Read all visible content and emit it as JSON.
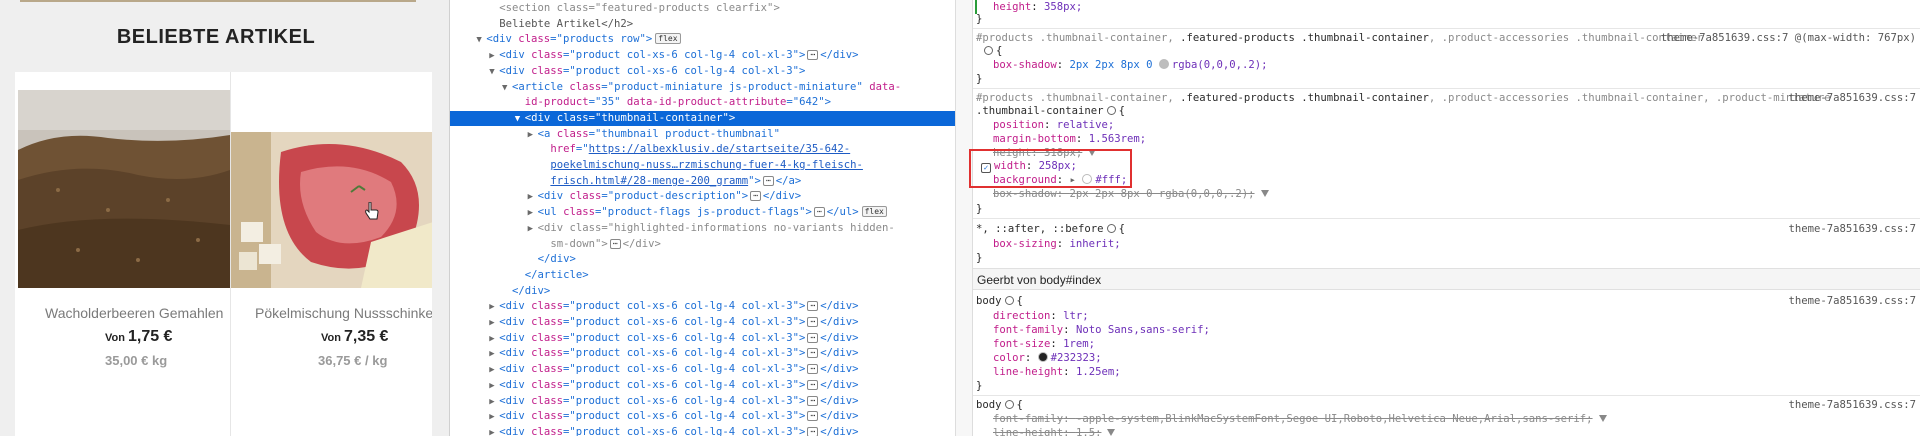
{
  "store": {
    "heading": "BELIEBTE ARTIKEL",
    "products": [
      {
        "name": "Wacholderbeeren Gemahlen",
        "von": "Von",
        "price": "1,75 €",
        "unit": "35,00 € kg"
      },
      {
        "name": "Pökelmischung Nussschinken",
        "von": "Von",
        "price": "7,35 €",
        "unit": "36,75 € / kg"
      }
    ]
  },
  "dom": {
    "lines": [
      {
        "indent": 8,
        "tw": "",
        "parts": [
          [
            "cm",
            "<section class=\"featured-products clearfix\">"
          ]
        ]
      },
      {
        "indent": 8,
        "tw": "",
        "parts": [
          [
            "tx",
            "Beliebte Artikel</h2>"
          ]
        ]
      },
      {
        "indent": 6,
        "tw": "▼",
        "parts": [
          [
            "tg",
            "<div "
          ],
          [
            "at",
            "class"
          ],
          [
            "tg",
            "=\""
          ],
          [
            "av",
            "products row"
          ],
          [
            "tg",
            "\">"
          ],
          [
            "badge",
            "flex"
          ]
        ]
      },
      {
        "indent": 8,
        "tw": "▶",
        "parts": [
          [
            "tg",
            "<div "
          ],
          [
            "at",
            "class"
          ],
          [
            "tg",
            "=\""
          ],
          [
            "av",
            "product col-xs-6 col-lg-4 col-xl-3"
          ],
          [
            "tg",
            "\">"
          ],
          [
            "dots",
            "⋯"
          ],
          [
            "tg",
            "</div>"
          ]
        ]
      },
      {
        "indent": 8,
        "tw": "▼",
        "parts": [
          [
            "tg",
            "<div "
          ],
          [
            "at",
            "class"
          ],
          [
            "tg",
            "=\""
          ],
          [
            "av",
            "product col-xs-6 col-lg-4 col-xl-3"
          ],
          [
            "tg",
            "\">"
          ]
        ]
      },
      {
        "indent": 10,
        "tw": "▼",
        "parts": [
          [
            "tg",
            "<article "
          ],
          [
            "at",
            "class"
          ],
          [
            "tg",
            "=\""
          ],
          [
            "av",
            "product-miniature js-product-miniature"
          ],
          [
            "tg",
            "\" "
          ],
          [
            "at",
            "data-"
          ]
        ]
      },
      {
        "indent": 12,
        "tw": "",
        "parts": [
          [
            "at",
            "id-product"
          ],
          [
            "tg",
            "=\""
          ],
          [
            "av",
            "35"
          ],
          [
            "tg",
            "\" "
          ],
          [
            "at",
            "data-id-product-attribute"
          ],
          [
            "tg",
            "=\""
          ],
          [
            "av",
            "642"
          ],
          [
            "tg",
            "\">"
          ]
        ]
      },
      {
        "indent": 12,
        "tw": "▼",
        "sel": true,
        "parts": [
          [
            "tg",
            "<div "
          ],
          [
            "at",
            "class"
          ],
          [
            "tg",
            "=\""
          ],
          [
            "av",
            "thumbnail-container"
          ],
          [
            "tg",
            "\">"
          ]
        ]
      },
      {
        "indent": 14,
        "tw": "▶",
        "parts": [
          [
            "tg",
            "<a "
          ],
          [
            "at",
            "class"
          ],
          [
            "tg",
            "=\""
          ],
          [
            "av",
            "thumbnail product-thumbnail"
          ],
          [
            "tg",
            "\""
          ]
        ]
      },
      {
        "indent": 16,
        "tw": "",
        "parts": [
          [
            "at",
            "href"
          ],
          [
            "tg",
            "=\""
          ],
          [
            "lk",
            "https://albexklusiv.de/startseite/35-642-"
          ]
        ]
      },
      {
        "indent": 16,
        "tw": "",
        "parts": [
          [
            "lk",
            "poekelmischung-nuss…rzmischung-fuer-4-kg-fleisch-"
          ]
        ]
      },
      {
        "indent": 16,
        "tw": "",
        "parts": [
          [
            "lk",
            "frisch.html#/28-menge-200_gramm"
          ],
          [
            "tg",
            "\">"
          ],
          [
            "dots",
            "⋯"
          ],
          [
            "tg",
            "</a>"
          ]
        ]
      },
      {
        "indent": 14,
        "tw": "▶",
        "parts": [
          [
            "tg",
            "<div "
          ],
          [
            "at",
            "class"
          ],
          [
            "tg",
            "=\""
          ],
          [
            "av",
            "product-description"
          ],
          [
            "tg",
            "\">"
          ],
          [
            "dots",
            "⋯"
          ],
          [
            "tg",
            "</div>"
          ]
        ]
      },
      {
        "indent": 14,
        "tw": "▶",
        "parts": [
          [
            "tg",
            "<ul "
          ],
          [
            "at",
            "class"
          ],
          [
            "tg",
            "=\""
          ],
          [
            "av",
            "product-flags js-product-flags"
          ],
          [
            "tg",
            "\">"
          ],
          [
            "dots",
            "⋯"
          ],
          [
            "tg",
            "</ul>"
          ],
          [
            "badge",
            "flex"
          ]
        ]
      },
      {
        "indent": 14,
        "tw": "▶",
        "parts": [
          [
            "cm",
            "<div class=\"highlighted-informations no-variants hidden-"
          ]
        ]
      },
      {
        "indent": 16,
        "tw": "",
        "parts": [
          [
            "cm",
            "sm-down\">"
          ],
          [
            "dots",
            "⋯"
          ],
          [
            "cm",
            "</div>"
          ]
        ]
      },
      {
        "indent": 14,
        "tw": "",
        "parts": [
          [
            "tg",
            "</div>"
          ]
        ]
      },
      {
        "indent": 12,
        "tw": "",
        "parts": [
          [
            "tg",
            "</article>"
          ]
        ]
      },
      {
        "indent": 10,
        "tw": "",
        "parts": [
          [
            "tg",
            "</div>"
          ]
        ]
      },
      {
        "indent": 8,
        "tw": "▶",
        "parts": [
          [
            "tg",
            "<div "
          ],
          [
            "at",
            "class"
          ],
          [
            "tg",
            "=\""
          ],
          [
            "av",
            "product col-xs-6 col-lg-4 col-xl-3"
          ],
          [
            "tg",
            "\">"
          ],
          [
            "dots",
            "⋯"
          ],
          [
            "tg",
            "</div>"
          ]
        ]
      },
      {
        "indent": 8,
        "tw": "▶",
        "parts": [
          [
            "tg",
            "<div "
          ],
          [
            "at",
            "class"
          ],
          [
            "tg",
            "=\""
          ],
          [
            "av",
            "product col-xs-6 col-lg-4 col-xl-3"
          ],
          [
            "tg",
            "\">"
          ],
          [
            "dots",
            "⋯"
          ],
          [
            "tg",
            "</div>"
          ]
        ]
      },
      {
        "indent": 8,
        "tw": "▶",
        "parts": [
          [
            "tg",
            "<div "
          ],
          [
            "at",
            "class"
          ],
          [
            "tg",
            "=\""
          ],
          [
            "av",
            "product col-xs-6 col-lg-4 col-xl-3"
          ],
          [
            "tg",
            "\">"
          ],
          [
            "dots",
            "⋯"
          ],
          [
            "tg",
            "</div>"
          ]
        ]
      },
      {
        "indent": 8,
        "tw": "▶",
        "parts": [
          [
            "tg",
            "<div "
          ],
          [
            "at",
            "class"
          ],
          [
            "tg",
            "=\""
          ],
          [
            "av",
            "product col-xs-6 col-lg-4 col-xl-3"
          ],
          [
            "tg",
            "\">"
          ],
          [
            "dots",
            "⋯"
          ],
          [
            "tg",
            "</div>"
          ]
        ]
      },
      {
        "indent": 8,
        "tw": "▶",
        "parts": [
          [
            "tg",
            "<div "
          ],
          [
            "at",
            "class"
          ],
          [
            "tg",
            "=\""
          ],
          [
            "av",
            "product col-xs-6 col-lg-4 col-xl-3"
          ],
          [
            "tg",
            "\">"
          ],
          [
            "dots",
            "⋯"
          ],
          [
            "tg",
            "</div>"
          ]
        ]
      },
      {
        "indent": 8,
        "tw": "▶",
        "parts": [
          [
            "tg",
            "<div "
          ],
          [
            "at",
            "class"
          ],
          [
            "tg",
            "=\""
          ],
          [
            "av",
            "product col-xs-6 col-lg-4 col-xl-3"
          ],
          [
            "tg",
            "\">"
          ],
          [
            "dots",
            "⋯"
          ],
          [
            "tg",
            "</div>"
          ]
        ]
      },
      {
        "indent": 8,
        "tw": "▶",
        "parts": [
          [
            "tg",
            "<div "
          ],
          [
            "at",
            "class"
          ],
          [
            "tg",
            "=\""
          ],
          [
            "av",
            "product col-xs-6 col-lg-4 col-xl-3"
          ],
          [
            "tg",
            "\">"
          ],
          [
            "dots",
            "⋯"
          ],
          [
            "tg",
            "</div>"
          ]
        ]
      },
      {
        "indent": 8,
        "tw": "▶",
        "parts": [
          [
            "tg",
            "<div "
          ],
          [
            "at",
            "class"
          ],
          [
            "tg",
            "=\""
          ],
          [
            "av",
            "product col-xs-6 col-lg-4 col-xl-3"
          ],
          [
            "tg",
            "\">"
          ],
          [
            "dots",
            "⋯"
          ],
          [
            "tg",
            "</div>"
          ]
        ]
      },
      {
        "indent": 8,
        "tw": "▶",
        "parts": [
          [
            "tg",
            "<div "
          ],
          [
            "at",
            "class"
          ],
          [
            "tg",
            "=\""
          ],
          [
            "av",
            "product col-xs-6 col-lg-4 col-xl-3"
          ],
          [
            "tg",
            "\">"
          ],
          [
            "dots",
            "⋯"
          ],
          [
            "tg",
            "</div>"
          ]
        ]
      }
    ]
  },
  "rules": {
    "r0_prop": "height",
    "r0_val": "358px;",
    "r1_sel_a": "#products .thumbnail-container, ",
    "r1_sel_b": ".featured-products .thumbnail-container",
    "r1_sel_c": ", .product-accessories .thumbnail-container",
    "r1_src": "theme-7a851639.css:7 @(max-width: 767px)",
    "r1_prop": "box-shadow",
    "r1_val_a": "2px 2px 8px 0",
    "r1_val_b": "rgba(0,0,0,.2);",
    "r2_sel_a": "#products .thumbnail-container, ",
    "r2_sel_b": ".featured-products .thumbnail-container",
    "r2_sel_c": ", .product-accessories .thumbnail-container, .product-miniature",
    "r2_sel_d": ".thumbnail-container",
    "r2_src": "theme-7a851639.css:7",
    "r2_props": [
      {
        "p": "position",
        "v": "relative;"
      },
      {
        "p": "margin-bottom",
        "v": "1.563rem;"
      },
      {
        "p": "height",
        "v": "318px;",
        "strike": true
      },
      {
        "p": "width",
        "v": "258px;"
      },
      {
        "p": "background",
        "v": "#fff;"
      },
      {
        "p": "box-shadow",
        "v": "2px 2px 8px 0 rgba(0,0,0,.2);",
        "strike": true
      }
    ],
    "r3_sel": "*, ::after, ::before",
    "r3_src": "theme-7a851639.css:7",
    "r3_prop": "box-sizing",
    "r3_val": "inherit;",
    "inherited": "Geerbt von body#index",
    "r4_sel": "body",
    "r4_src": "theme-7a851639.css:7",
    "r4_props": [
      {
        "p": "direction",
        "v": "ltr;"
      },
      {
        "p": "font-family",
        "v": "Noto Sans,sans-serif;"
      },
      {
        "p": "font-size",
        "v": "1rem;"
      },
      {
        "p": "color",
        "v": "#232323;"
      },
      {
        "p": "line-height",
        "v": "1.25em;"
      }
    ],
    "r5_sel": "body",
    "r5_src": "theme-7a851639.css:7",
    "r5_props": [
      {
        "p": "font-family",
        "v": "-apple-system,BlinkMacSystemFont,Segoe UI,Roboto,Helvetica Neue,Arial,sans-serif;"
      },
      {
        "p": "line-height",
        "v": "1.5;"
      }
    ]
  },
  "colors": {
    "selection": "#0b67d8",
    "highlight_box": "#e03030",
    "text": "#232323"
  }
}
